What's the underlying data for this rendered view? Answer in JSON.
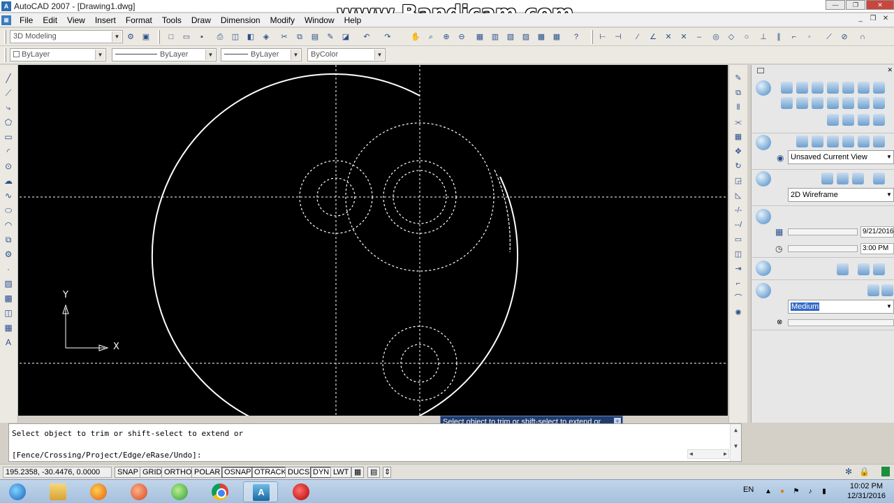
{
  "window": {
    "title": "AutoCAD 2007 - [Drawing1.dwg]",
    "watermark": "www.Bandicam.com"
  },
  "menu": {
    "items": [
      "File",
      "Edit",
      "View",
      "Insert",
      "Format",
      "Tools",
      "Draw",
      "Dimension",
      "Modify",
      "Window",
      "Help"
    ]
  },
  "toolbar": {
    "workspace": "3D Modeling",
    "layer": "ByLayer",
    "linetype": "ByLayer",
    "lineweight": "ByLayer",
    "color": "ByColor"
  },
  "ucs": {
    "x_label": "X",
    "y_label": "Y"
  },
  "dashboard": {
    "view": "Unsaved Current View",
    "visual_style": "2D Wireframe",
    "date": "9/21/2016",
    "time": "3:00 PM",
    "quality": "Medium"
  },
  "tooltip": {
    "text": "Select object to trim or shift-select to extend or"
  },
  "command": {
    "line1": "Select object to trim or shift-select to extend or",
    "line2": "[Fence/Crossing/Project/Edge/eRase/Undo]:"
  },
  "status": {
    "coords": "195.2358, -30.4476, 0.0000",
    "buttons": [
      {
        "label": "SNAP",
        "on": false
      },
      {
        "label": "GRID",
        "on": false
      },
      {
        "label": "ORTHO",
        "on": false
      },
      {
        "label": "POLAR",
        "on": false
      },
      {
        "label": "OSNAP",
        "on": true
      },
      {
        "label": "OTRACK",
        "on": true
      },
      {
        "label": "DUCS",
        "on": false
      },
      {
        "label": "DYN",
        "on": true
      },
      {
        "label": "LWT",
        "on": false
      }
    ]
  },
  "taskbar": {
    "lang": "EN",
    "time": "10:02 PM",
    "date": "12/31/2016"
  },
  "colors": {
    "canvas": "#000000",
    "tooltip_bg": "#1f3c6e",
    "geometry": "#ffffff"
  }
}
